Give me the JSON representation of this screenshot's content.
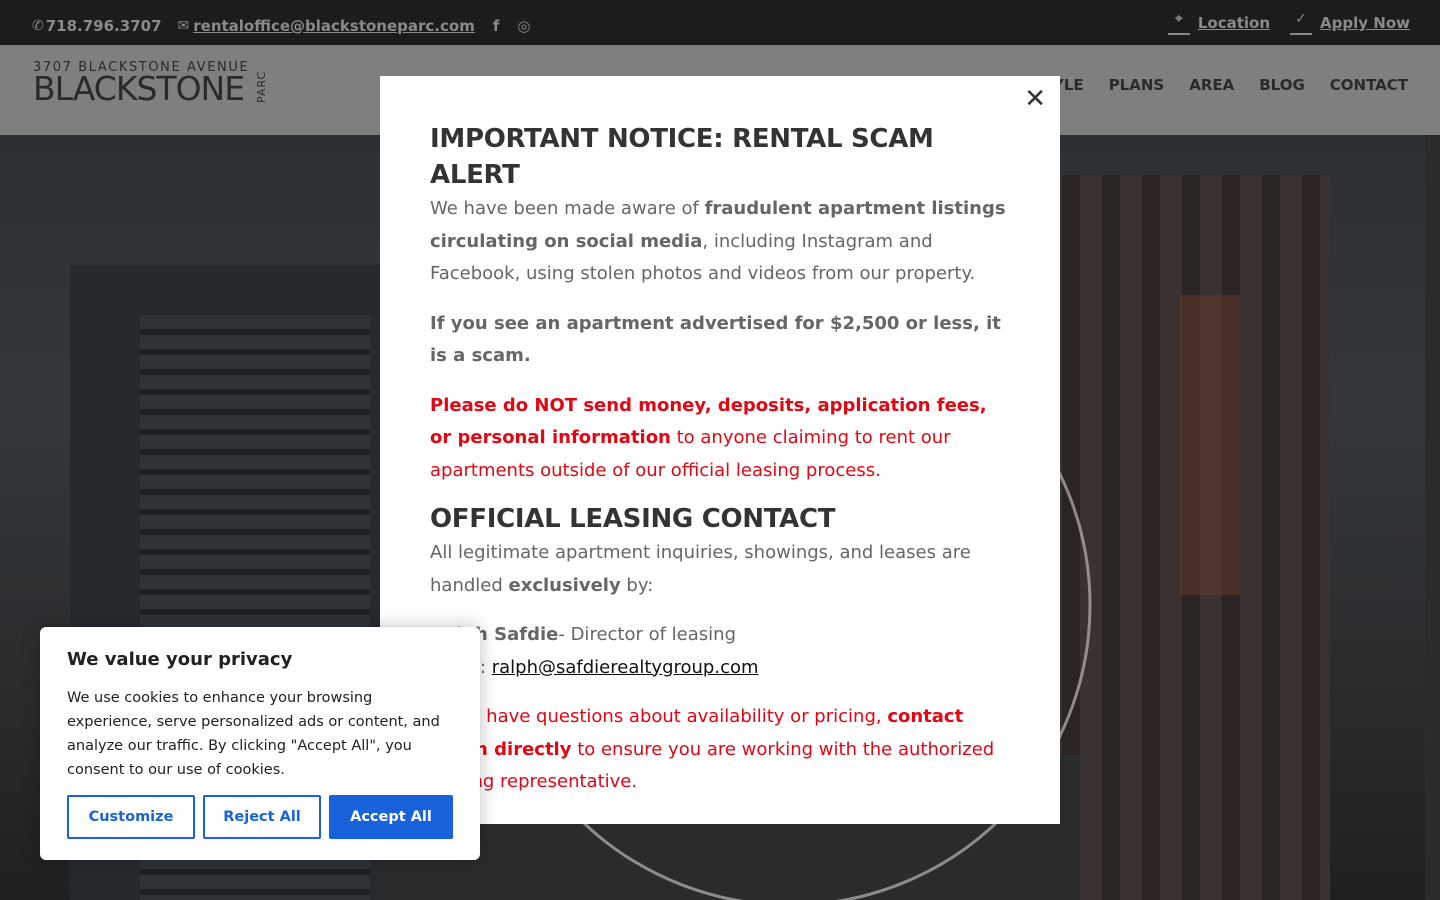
{
  "topbar": {
    "phone": "718.796.3707",
    "email": "rentaloffice@blackstoneparc.com",
    "social": [
      "facebook-icon",
      "instagram-icon"
    ],
    "links": [
      {
        "label": "Location",
        "icon": "map-pin-icon"
      },
      {
        "label": "Apply Now",
        "icon": "checkmark-icon"
      }
    ]
  },
  "header": {
    "logo_address": "3707 BLACKSTONE AVENUE",
    "logo_name": "BLACKSTONE",
    "logo_parc": "PARC",
    "nav": [
      "ESTYLE",
      "PLANS",
      "AREA",
      "BLOG",
      "CONTACT"
    ]
  },
  "modal": {
    "title": "IMPORTANT NOTICE: RENTAL SCAM ALERT",
    "p1_pre": "We have been made aware of ",
    "p1_bold": "fraudulent apartment listings circulating on social media",
    "p1_post": ", including Instagram and Facebook, using stolen photos and videos from our property.",
    "p2": "If you see an apartment advertised for $2,500 or less, it is a scam.",
    "p3_bold": "Please do NOT send money, deposits, application fees, or personal information",
    "p3_post": " to anyone claiming to rent our apartments outside of our official leasing process.",
    "heading2": "OFFICIAL LEASING CONTACT",
    "p4_pre": "All legitimate apartment inquiries, showings, and leases are handled ",
    "p4_bold": "exclusively",
    "p4_post": " by:",
    "contact_name": "Ralph Safdie",
    "contact_role": "- Director of leasing",
    "contact_email_label": "Email: ",
    "contact_email": "ralph@safdierealtygroup.com",
    "p5_pre": "If you have questions about availability or pricing, ",
    "p5_bold": "contact Ralph directly",
    "p5_post": " to ensure you are working with the authorized leasing representative.",
    "close_icon": "close-icon"
  },
  "cookie": {
    "title": "We value your privacy",
    "text": "We use cookies to enhance your browsing experience, serve personalized ads or content, and analyze our traffic. By clicking \"Accept All\", you consent to our use of cookies.",
    "customize": "Customize",
    "reject": "Reject All",
    "accept": "Accept All"
  },
  "colors": {
    "accent_blue": "#1863dc",
    "alert_red": "#e30613",
    "topbar_bg": "#1c1c1c"
  }
}
